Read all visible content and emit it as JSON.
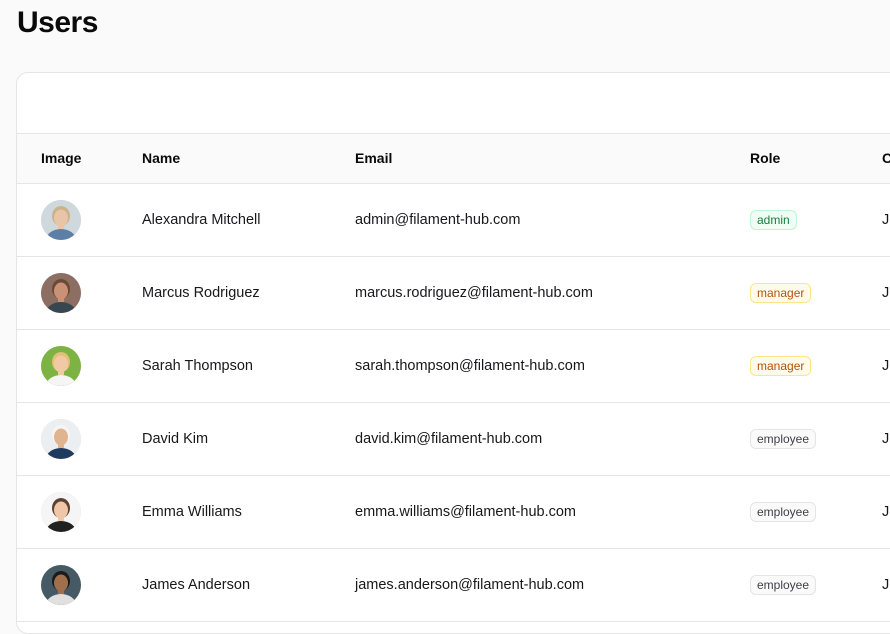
{
  "page": {
    "title": "Users"
  },
  "table": {
    "columns": {
      "image": "Image",
      "name": "Name",
      "email": "Email",
      "role": "Role",
      "created": "C"
    },
    "rows": [
      {
        "name": "Alexandra Mitchell",
        "email": "admin@filament-hub.com",
        "role": "admin",
        "role_color": "success",
        "created": "J",
        "avatar": {
          "skin": "#e8c4a8",
          "hair": "#c9b48a",
          "bg": "#cfd8dc",
          "shirt": "#5b7fa6"
        }
      },
      {
        "name": "Marcus Rodriguez",
        "email": "marcus.rodriguez@filament-hub.com",
        "role": "manager",
        "role_color": "warning",
        "created": "J",
        "avatar": {
          "skin": "#c99276",
          "hair": "#6b4a34",
          "bg": "#8d6e63",
          "shirt": "#37474f"
        }
      },
      {
        "name": "Sarah Thompson",
        "email": "sarah.thompson@filament-hub.com",
        "role": "manager",
        "role_color": "warning",
        "created": "J",
        "avatar": {
          "skin": "#f1c9a5",
          "hair": "#e3c07a",
          "bg": "#7cb342",
          "shirt": "#f5f5f5"
        }
      },
      {
        "name": "David Kim",
        "email": "david.kim@filament-hub.com",
        "role": "employee",
        "role_color": "gray",
        "created": "J",
        "avatar": {
          "skin": "#e0b48f",
          "hair": "#f5f5f5",
          "bg": "#eceff1",
          "shirt": "#1e3a5f"
        }
      },
      {
        "name": "Emma Williams",
        "email": "emma.williams@filament-hub.com",
        "role": "employee",
        "role_color": "gray",
        "created": "J",
        "avatar": {
          "skin": "#efc6a8",
          "hair": "#5d4030",
          "bg": "#f5f5f5",
          "shirt": "#212121"
        }
      },
      {
        "name": "James Anderson",
        "email": "james.anderson@filament-hub.com",
        "role": "employee",
        "role_color": "gray",
        "created": "J",
        "avatar": {
          "skin": "#a0704d",
          "hair": "#1a1a1a",
          "bg": "#455a64",
          "shirt": "#e0e0e0"
        }
      }
    ]
  }
}
